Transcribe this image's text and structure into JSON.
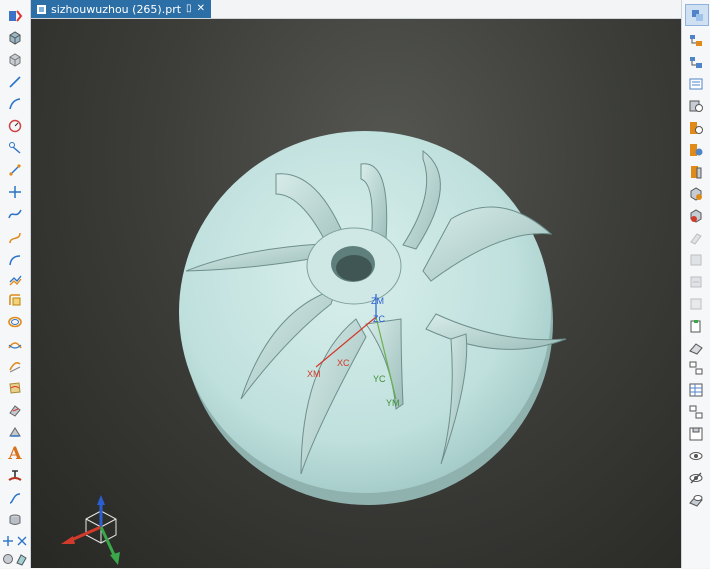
{
  "window": {
    "tab_title": "sizhouwuzhou (265).prt"
  },
  "left_toolbar": {
    "text_tool_label": "A"
  },
  "viewport": {
    "axis_labels": {
      "zm": "ZM",
      "zc": "ZC",
      "xm": "XM",
      "xc": "XC",
      "yc": "YC",
      "ym": "YM"
    }
  },
  "colors": {
    "tab": "#2c6fa7",
    "part": "#bfe0dd",
    "background": "#3d3e3a"
  }
}
